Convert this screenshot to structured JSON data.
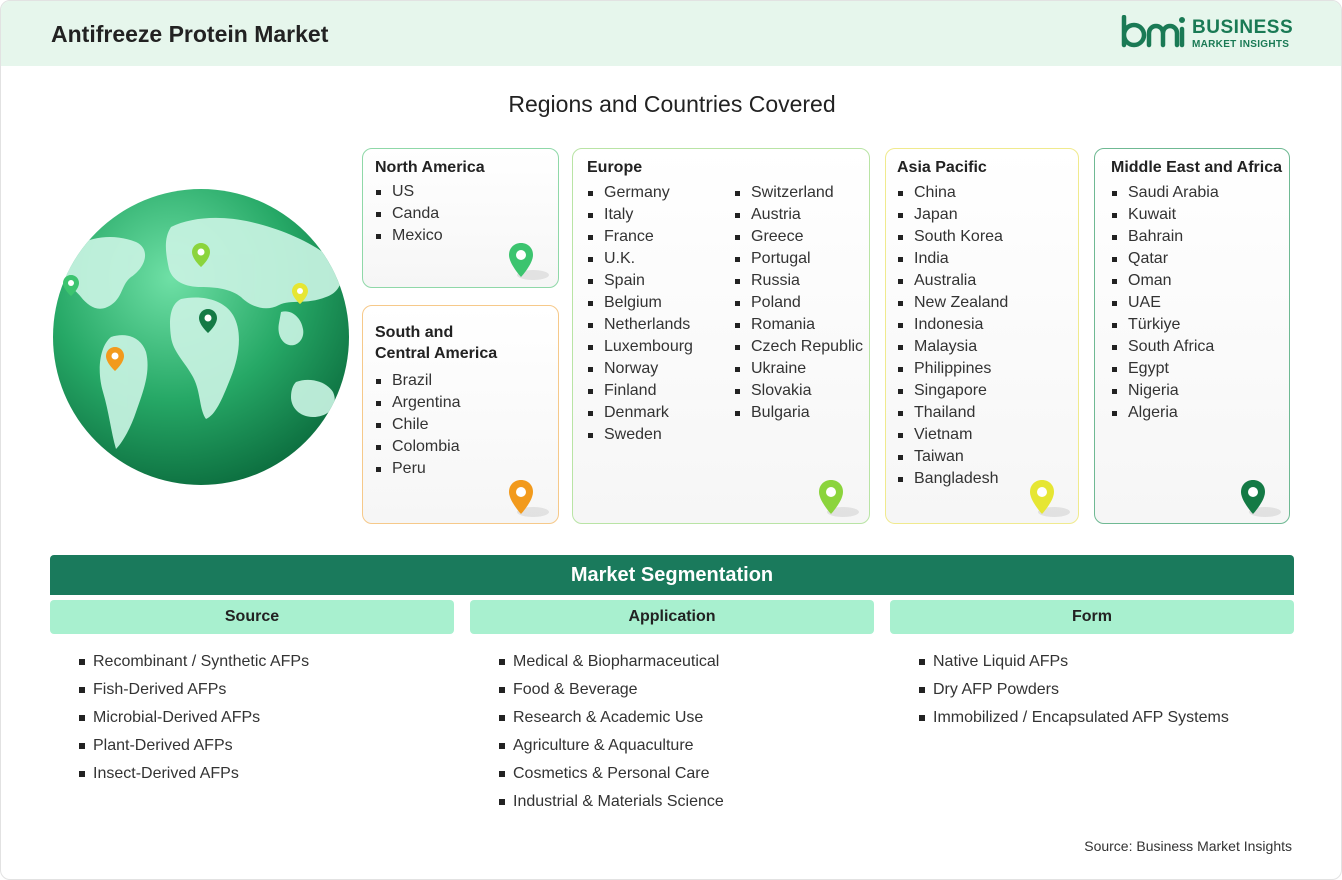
{
  "header": {
    "title": "Antifreeze Protein Market",
    "logo": {
      "mark": "bmi",
      "line1": "BUSINESS",
      "line2": "MARKET INSIGHTS"
    }
  },
  "regions": {
    "title": "Regions and Countries Covered",
    "north_america": {
      "title": "North America",
      "countries": [
        "US",
        "Canda",
        "Mexico"
      ]
    },
    "south_central_america": {
      "title_line1": "South and",
      "title_line2": "Central America",
      "countries": [
        "Brazil",
        "Argentina",
        "Chile",
        "Colombia",
        "Peru"
      ]
    },
    "europe": {
      "title": "Europe",
      "countries_col1": [
        "Germany",
        "Italy",
        "France",
        "U.K.",
        "Spain",
        "Belgium",
        "Netherlands",
        "Luxembourg",
        "Norway",
        "Finland",
        "Denmark",
        "Sweden"
      ],
      "countries_col2": [
        "Switzerland",
        "Austria",
        "Greece",
        "Portugal",
        "Russia",
        "Poland",
        "Romania",
        "Czech Republic",
        "Ukraine",
        "Slovakia",
        "Bulgaria"
      ]
    },
    "asia_pacific": {
      "title": "Asia Pacific",
      "countries": [
        "China",
        "Japan",
        "South Korea",
        "India",
        "Australia",
        "New Zealand",
        "Indonesia",
        "Malaysia",
        "Philippines",
        "Singapore",
        "Thailand",
        "Vietnam",
        "Taiwan",
        "Bangladesh"
      ]
    },
    "middle_east_africa": {
      "title": "Middle East and Africa",
      "countries": [
        "Saudi Arabia",
        "Kuwait",
        "Bahrain",
        "Qatar",
        "Oman",
        "UAE",
        "Türkiye",
        "South Africa",
        "Egypt",
        "Nigeria",
        "Algeria"
      ]
    }
  },
  "segmentation": {
    "title": "Market Segmentation",
    "columns": [
      {
        "heading": "Source",
        "items": [
          "Recombinant / Synthetic AFPs",
          "Fish-Derived AFPs",
          "Microbial-Derived AFPs",
          "Plant-Derived AFPs",
          "Insect-Derived AFPs"
        ]
      },
      {
        "heading": "Application",
        "items": [
          "Medical & Biopharmaceutical",
          "Food & Beverage",
          "Research & Academic Use",
          "Agriculture & Aquaculture",
          "Cosmetics & Personal Care",
          "Industrial & Materials Science"
        ]
      },
      {
        "heading": "Form",
        "items": [
          "Native Liquid AFPs",
          "Dry AFP Powders",
          "Immobilized / Encapsulated AFP Systems"
        ]
      }
    ]
  },
  "source_note": "Source: Business Market Insights",
  "colors": {
    "header_bg": "#e6f6ec",
    "brand_green": "#1a7a5c",
    "segment_head": "#a8f0cf",
    "pin_north_america": "#3cc46f",
    "pin_south_america": "#f29a1c",
    "pin_europe": "#8bd43c",
    "pin_asia_pacific": "#e6e633",
    "pin_mea": "#147a45"
  },
  "icons": [
    "globe-icon",
    "location-pin-icon",
    "bmi-logo"
  ]
}
